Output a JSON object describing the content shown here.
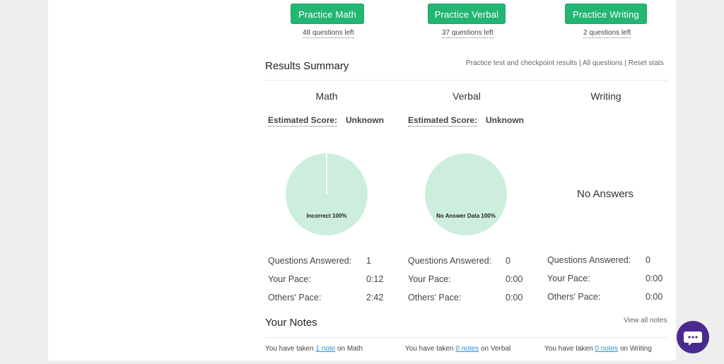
{
  "practice": [
    {
      "label": "Practice Math",
      "left": "48 questions left"
    },
    {
      "label": "Practice Verbal",
      "left": "37 questions left"
    },
    {
      "label": "Practice Writing",
      "left": "2 questions left"
    }
  ],
  "results": {
    "title": "Results Summary",
    "links": [
      "Practice test and checkpoint results",
      "All questions",
      "Reset stats"
    ],
    "separator": " | ",
    "subjects": [
      "Math",
      "Verbal",
      "Writing"
    ],
    "estimated_label": "Estimated Score:",
    "estimated_values": [
      "Unknown",
      "Unknown"
    ],
    "pies": [
      {
        "label": "Incorrect 100%"
      },
      {
        "label": "No Answer Data 100%"
      }
    ],
    "no_answers": "No Answers",
    "stat_labels": [
      "Questions Answered:",
      "Your Pace:",
      "Others' Pace:"
    ],
    "stats": [
      [
        "1",
        "0:12",
        "2:42"
      ],
      [
        "0",
        "0:00",
        "0:00"
      ],
      [
        "0",
        "0:00",
        "0:00"
      ]
    ]
  },
  "notes": {
    "title": "Your Notes",
    "view_all": "View all notes",
    "prefix": "You have taken",
    "items": [
      {
        "link": "1 note",
        "suffix": "on Math"
      },
      {
        "link": "0 notes",
        "suffix": "on Verbal"
      },
      {
        "link": "0 notes",
        "suffix": "on Writing"
      }
    ]
  },
  "colors": {
    "accent": "#23b673",
    "pie": "#cdeedd",
    "chat": "#4b2a8f",
    "link": "#2f8fd8"
  },
  "icons": {
    "chat": "chat-bubble-icon"
  }
}
